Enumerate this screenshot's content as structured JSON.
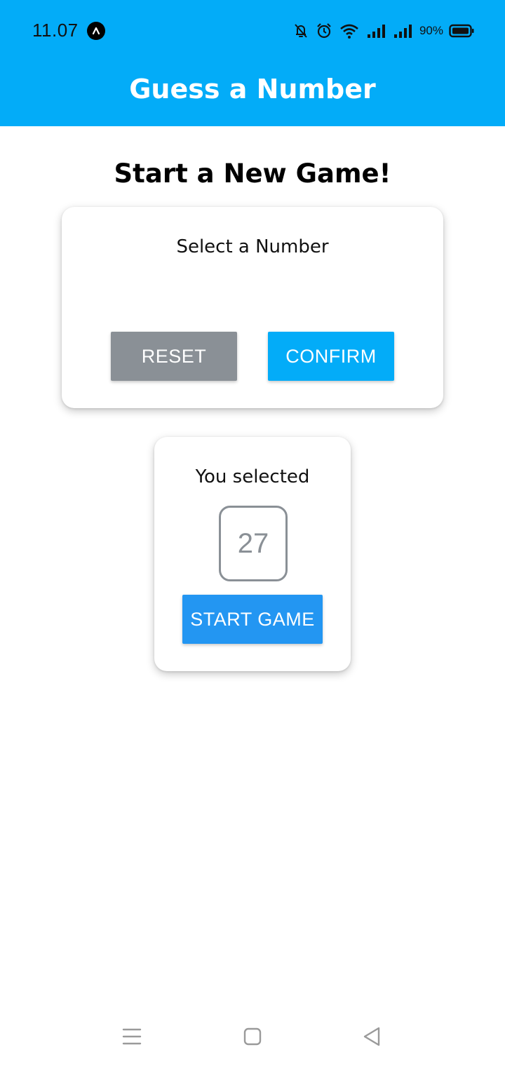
{
  "status_bar": {
    "time": "11.07",
    "battery_percent": "90%",
    "icons": [
      "app-notification-icon",
      "bell-off-icon",
      "alarm-icon",
      "wifi-icon",
      "signal-icon",
      "signal-icon",
      "battery-icon"
    ]
  },
  "header": {
    "title": "Guess a Number",
    "background_color": "#03acf8"
  },
  "main": {
    "title": "Start a New Game!",
    "input_card": {
      "label": "Select a Number",
      "input_value": "",
      "reset_label": "RESET",
      "confirm_label": "CONFIRM",
      "reset_color": "#8a9096",
      "confirm_color": "#03acf8"
    },
    "selected_card": {
      "label": "You selected",
      "number": "27",
      "start_label": "START GAME",
      "start_color": "#2396f2"
    }
  },
  "nav_bar": {
    "icons": [
      "menu-icon",
      "home-icon",
      "back-icon"
    ]
  }
}
